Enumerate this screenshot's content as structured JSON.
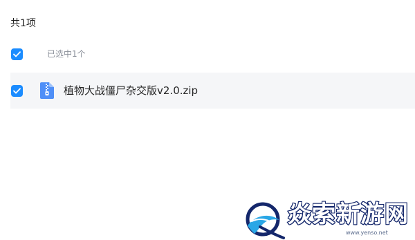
{
  "header": {
    "count_label": "共1项"
  },
  "selection": {
    "checked": true,
    "text": "已选中1个"
  },
  "files": [
    {
      "name": "植物大战僵尸杂交版v2.0.zip",
      "checked": true,
      "icon": "zip-file-icon"
    }
  ],
  "watermark": {
    "title": "焱索新游网",
    "url": "www.yenso.net"
  },
  "colors": {
    "accent": "#1b8cff",
    "row_background": "#f5f6f8",
    "watermark_navy": "#14276b"
  }
}
